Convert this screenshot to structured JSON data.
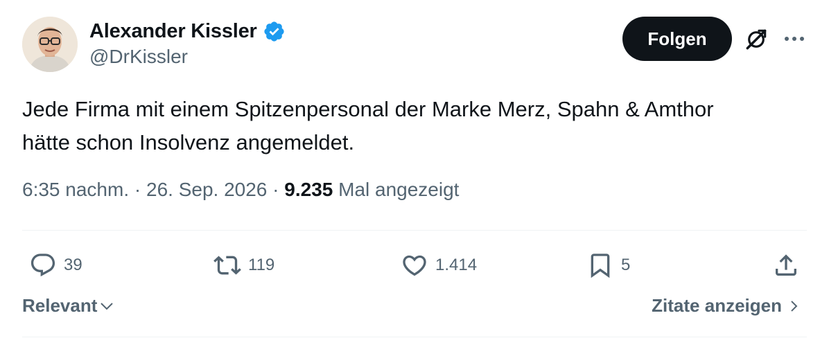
{
  "author": {
    "display_name": "Alexander Kissler",
    "handle": "@DrKissler",
    "verified": true
  },
  "header": {
    "follow_label": "Folgen",
    "icons": [
      "grok-icon",
      "more-icon"
    ]
  },
  "tweet": {
    "text_line1": "Jede Firma mit einem Spitzenpersonal der Marke Merz, Spahn & Amthor",
    "text_line2": "hätte schon Insolvenz angemeldet.",
    "time": "6:35 nachm.",
    "separator": "·",
    "date": "26. Sep. 2026",
    "views_count": "9.235",
    "views_label": "Mal angezeigt"
  },
  "actions": {
    "replies": "39",
    "retweets": "119",
    "likes": "1.414",
    "bookmarks": "5"
  },
  "footer": {
    "sort_label": "Relevant",
    "quotes_label": "Zitate anzeigen"
  },
  "colors": {
    "text_primary": "#0f1419",
    "text_secondary": "#536471",
    "verified_blue": "#1d9bf0",
    "follow_bg": "#0f1419",
    "divider": "#eff3f4"
  }
}
